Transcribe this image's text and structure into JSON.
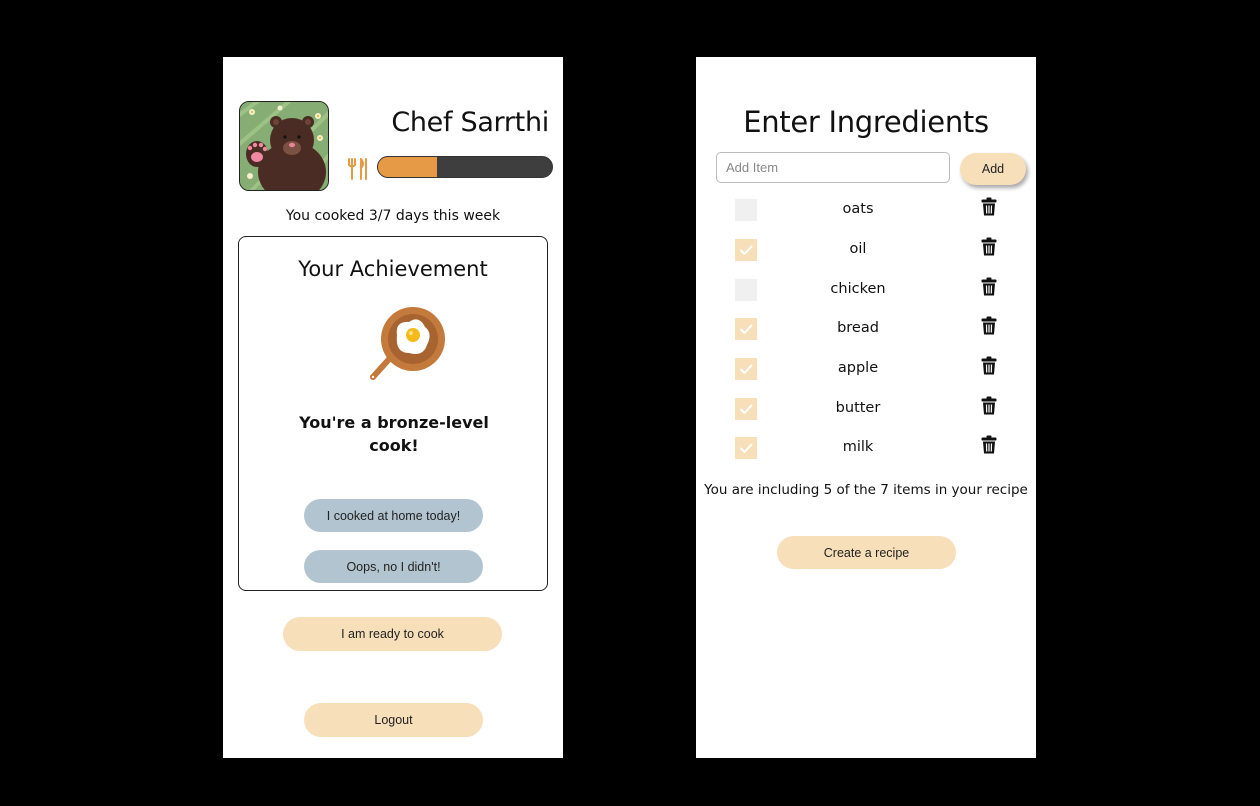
{
  "profile": {
    "name": "Chef Sarrthi",
    "avatar": "bear-waving-avatar",
    "cook_progress": 0.34,
    "progress_icon": "fork-knife-icon",
    "cooked_text": "You cooked 3/7 days this week"
  },
  "achievement": {
    "title": "Your Achievement",
    "icon": "frying-pan-egg-icon",
    "level_text": "You're a bronze-level cook!",
    "cooked_button": "I cooked at home today!",
    "not_cooked_button": "Oops, no I didn't!"
  },
  "actions": {
    "ready_button": "I am ready to cook",
    "logout_button": "Logout"
  },
  "ingredients": {
    "title": "Enter Ingredients",
    "input_placeholder": "Add Item",
    "add_button": "Add",
    "items": [
      {
        "name": "oats",
        "checked": false
      },
      {
        "name": "oil",
        "checked": true
      },
      {
        "name": "chicken",
        "checked": false
      },
      {
        "name": "bread",
        "checked": true
      },
      {
        "name": "apple",
        "checked": true
      },
      {
        "name": "butter",
        "checked": true
      },
      {
        "name": "milk",
        "checked": true
      }
    ],
    "summary": "You are including 5 of the 7 items in your recipe",
    "create_button": "Create a recipe",
    "delete_icon": "trash-icon"
  },
  "colors": {
    "accent_peach": "#f7dfba",
    "progress_orange": "#e79a45",
    "button_blue": "#b2c4cf",
    "background": "#000000"
  }
}
